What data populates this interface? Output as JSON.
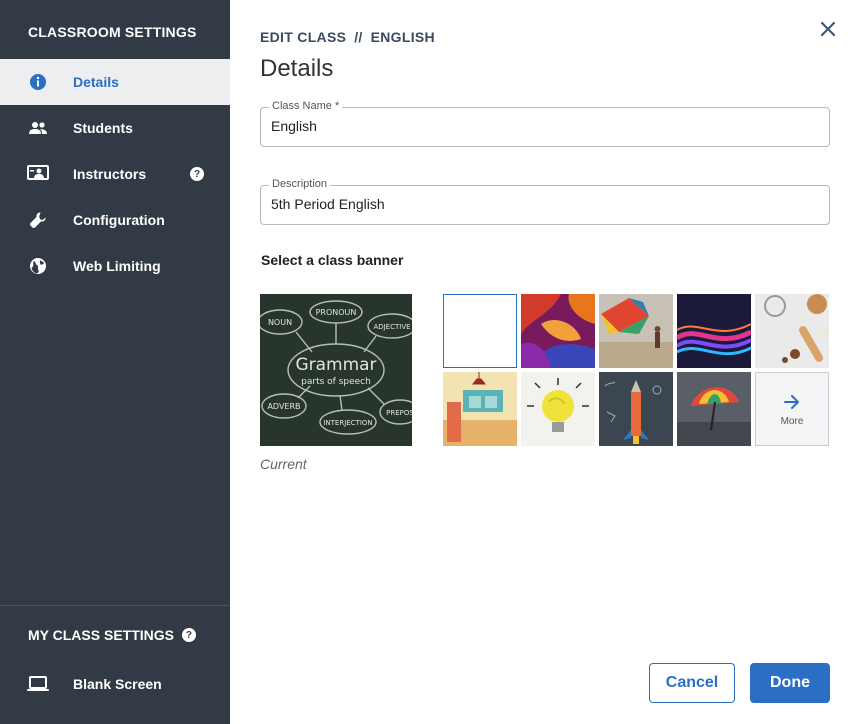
{
  "sidebar": {
    "title": "CLASSROOM SETTINGS",
    "items": [
      {
        "label": "Details",
        "icon": "info-icon",
        "active": true
      },
      {
        "label": "Students",
        "icon": "people-icon"
      },
      {
        "label": "Instructors",
        "icon": "instructor-icon",
        "help": "?"
      },
      {
        "label": "Configuration",
        "icon": "wrench-icon"
      },
      {
        "label": "Web Limiting",
        "icon": "globe-icon"
      }
    ],
    "my_settings": {
      "label": "MY CLASS SETTINGS",
      "help": "?"
    },
    "blank_screen": {
      "label": "Blank Screen",
      "icon": "laptop-icon"
    }
  },
  "header": {
    "crumb_prefix": "EDIT CLASS",
    "crumb_separator": "//",
    "crumb_class": "ENGLISH",
    "title": "Details"
  },
  "form": {
    "class_name": {
      "label": "Class Name *",
      "value": "English"
    },
    "description": {
      "label": "Description",
      "value": "5th Period English"
    }
  },
  "banner": {
    "section_label": "Select a class banner",
    "current_caption": "Current",
    "current_text": {
      "main": "Grammar",
      "sub": "parts of speech",
      "words": [
        "NOUN",
        "PRONOUN",
        "ADJECTIVE",
        "ADVERB",
        "INTERJECTION",
        "PREPOS"
      ]
    },
    "options": [
      {
        "name": "blank",
        "selected": true
      },
      {
        "name": "abstract-color"
      },
      {
        "name": "kite-beach"
      },
      {
        "name": "light-waves"
      },
      {
        "name": "baking"
      },
      {
        "name": "kitchen-room"
      },
      {
        "name": "lightbulb"
      },
      {
        "name": "pencil-rocket"
      },
      {
        "name": "rainbow-umbrella"
      }
    ],
    "more_label": "More"
  },
  "footer": {
    "cancel": "Cancel",
    "done": "Done"
  },
  "colors": {
    "sidebar_bg": "#323a45",
    "accent": "#2a6fc4",
    "active_bg": "#eceef0"
  }
}
